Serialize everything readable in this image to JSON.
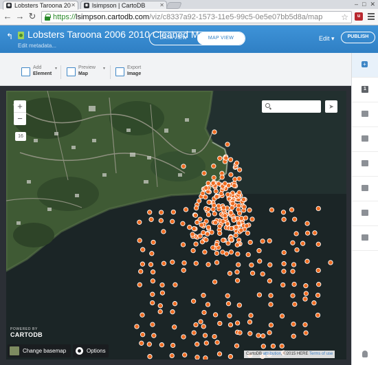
{
  "browser": {
    "tabs": [
      {
        "title": "Lobsters Taroona 20",
        "favicon": "cartodb-icon"
      },
      {
        "title": "lsimpson | CartoDB",
        "favicon": "cartodb-icon"
      }
    ],
    "url": {
      "scheme": "https://",
      "host": "lsimpson.cartodb.com",
      "path": "/viz/c8337a92-1573-11e5-99c5-0e5e07bb5d8a/map"
    },
    "extension_badge": "u"
  },
  "header": {
    "title": "Lobsters Taroona 2006 2010 Cleaned Map",
    "edit_metadata": "Edit metadata...",
    "data_view": "DATA VIEW",
    "map_view": "MAP VIEW",
    "edit_menu": "Edit",
    "publish": "PUBLISH",
    "accent_color": "#3b8ed3"
  },
  "tools": [
    {
      "line1": "Add",
      "line2": "Element",
      "icon": "add-element-icon"
    },
    {
      "line1": "Preview",
      "line2": "Map",
      "icon": "preview-map-icon"
    },
    {
      "line1": "Export",
      "line2": "Image",
      "icon": "export-image-icon"
    }
  ],
  "right_panel": {
    "layer_number": "1",
    "items": [
      "add-layer-icon",
      "layer-icon",
      "sql-icon",
      "wizard-icon",
      "infowindow-icon",
      "css-icon",
      "legend-icon",
      "filter-icon",
      "help-icon"
    ]
  },
  "map": {
    "zoom_in": "+",
    "zoom_out": "−",
    "zoom_level": "16",
    "search_placeholder": "",
    "powered_by": "POWERED BY",
    "brand": "CARTODB",
    "change_basemap": "Change basemap",
    "options": "Options",
    "attribution_prefix": "CartoDB ",
    "attribution_link": "attribution",
    "attribution_rest": ", ©2015 HERE ",
    "terms": "Terms of use",
    "point_color": "#ef6c21",
    "point_stroke": "#ffffff"
  }
}
